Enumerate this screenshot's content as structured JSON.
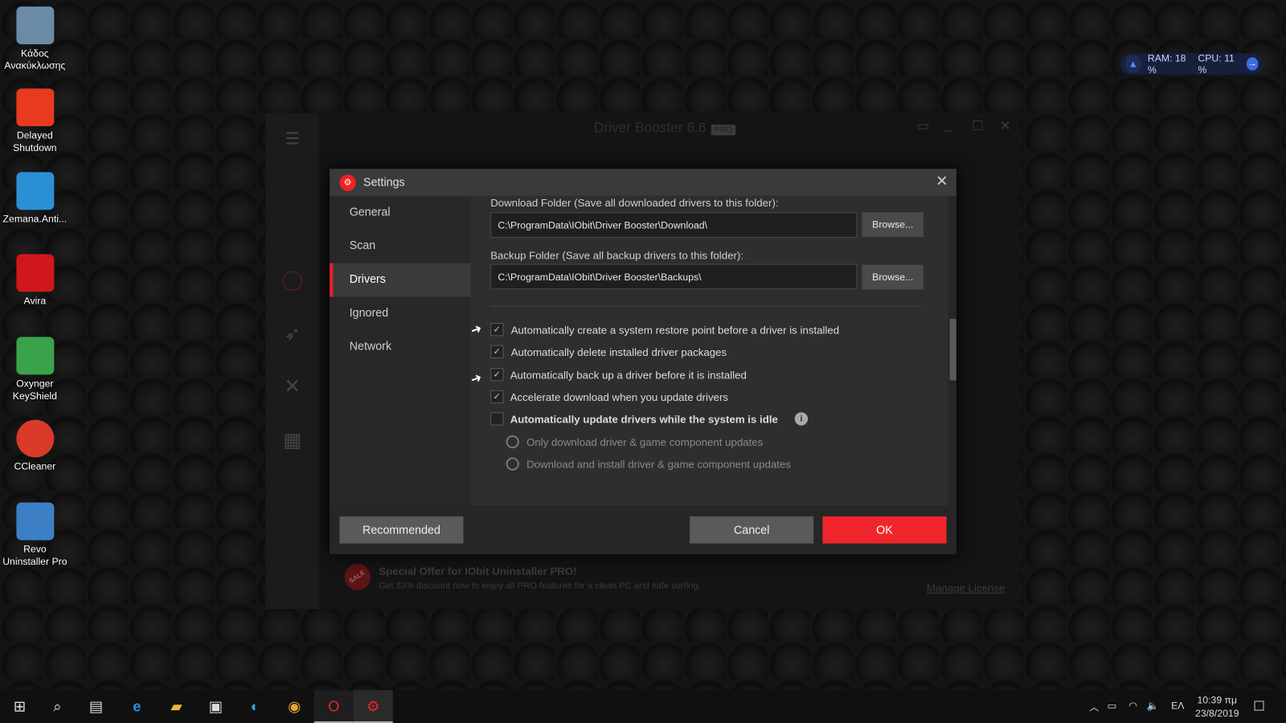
{
  "desktop": {
    "icons": [
      {
        "label": "Κάδος Ανακύκλωσης",
        "color": "#6b8aa8"
      },
      {
        "label": "Delayed Shutdown",
        "color": "#e83a1e"
      },
      {
        "label": "Zemana.Anti...",
        "color": "#2b8fd6"
      },
      {
        "label": "Avira",
        "color": "#d0171b"
      },
      {
        "label": "Oxynger KeyShield",
        "color": "#3aa24a"
      },
      {
        "label": "CCleaner",
        "color": "#d93a2a"
      },
      {
        "label": "Revo Uninstaller Pro",
        "color": "#3d7fc4"
      }
    ]
  },
  "monitor": {
    "ram": "RAM: 18 %",
    "cpu": "CPU: 11 %"
  },
  "app": {
    "title": "Driver Booster 6.6",
    "badge": "PRO",
    "promo_title": "Special Offer for IObit Uninstaller PRO!",
    "promo_text": "Get 83% discount now to enjoy all PRO features for a clean PC and safe surfing.",
    "sale": "SALE",
    "manage": "Manage License"
  },
  "settings": {
    "title": "Settings",
    "nav": [
      "General",
      "Scan",
      "Drivers",
      "Ignored",
      "Network"
    ],
    "selected": "Drivers",
    "download_label": "Download Folder (Save all downloaded drivers to this folder):",
    "download_path": "C:\\ProgramData\\IObit\\Driver Booster\\Download\\",
    "backup_label": "Backup Folder (Save all backup drivers to this folder):",
    "backup_path": "C:\\ProgramData\\IObit\\Driver Booster\\Backups\\",
    "browse": "Browse...",
    "options": [
      {
        "label": "Automatically create a system restore point before a driver is installed",
        "checked": true
      },
      {
        "label": "Automatically delete installed driver packages",
        "checked": true
      },
      {
        "label": "Automatically back up a driver before it is installed",
        "checked": true
      },
      {
        "label": "Accelerate download when you update drivers",
        "checked": true
      },
      {
        "label": "Automatically update drivers while the system is idle",
        "checked": false
      }
    ],
    "radios": [
      "Only download driver & game component updates",
      "Download and install driver & game component updates"
    ],
    "recommended": "Recommended",
    "cancel": "Cancel",
    "ok": "OK"
  },
  "taskbar": {
    "lang": "ΕΛ",
    "time": "10:39 πμ",
    "date": "23/8/2019"
  }
}
